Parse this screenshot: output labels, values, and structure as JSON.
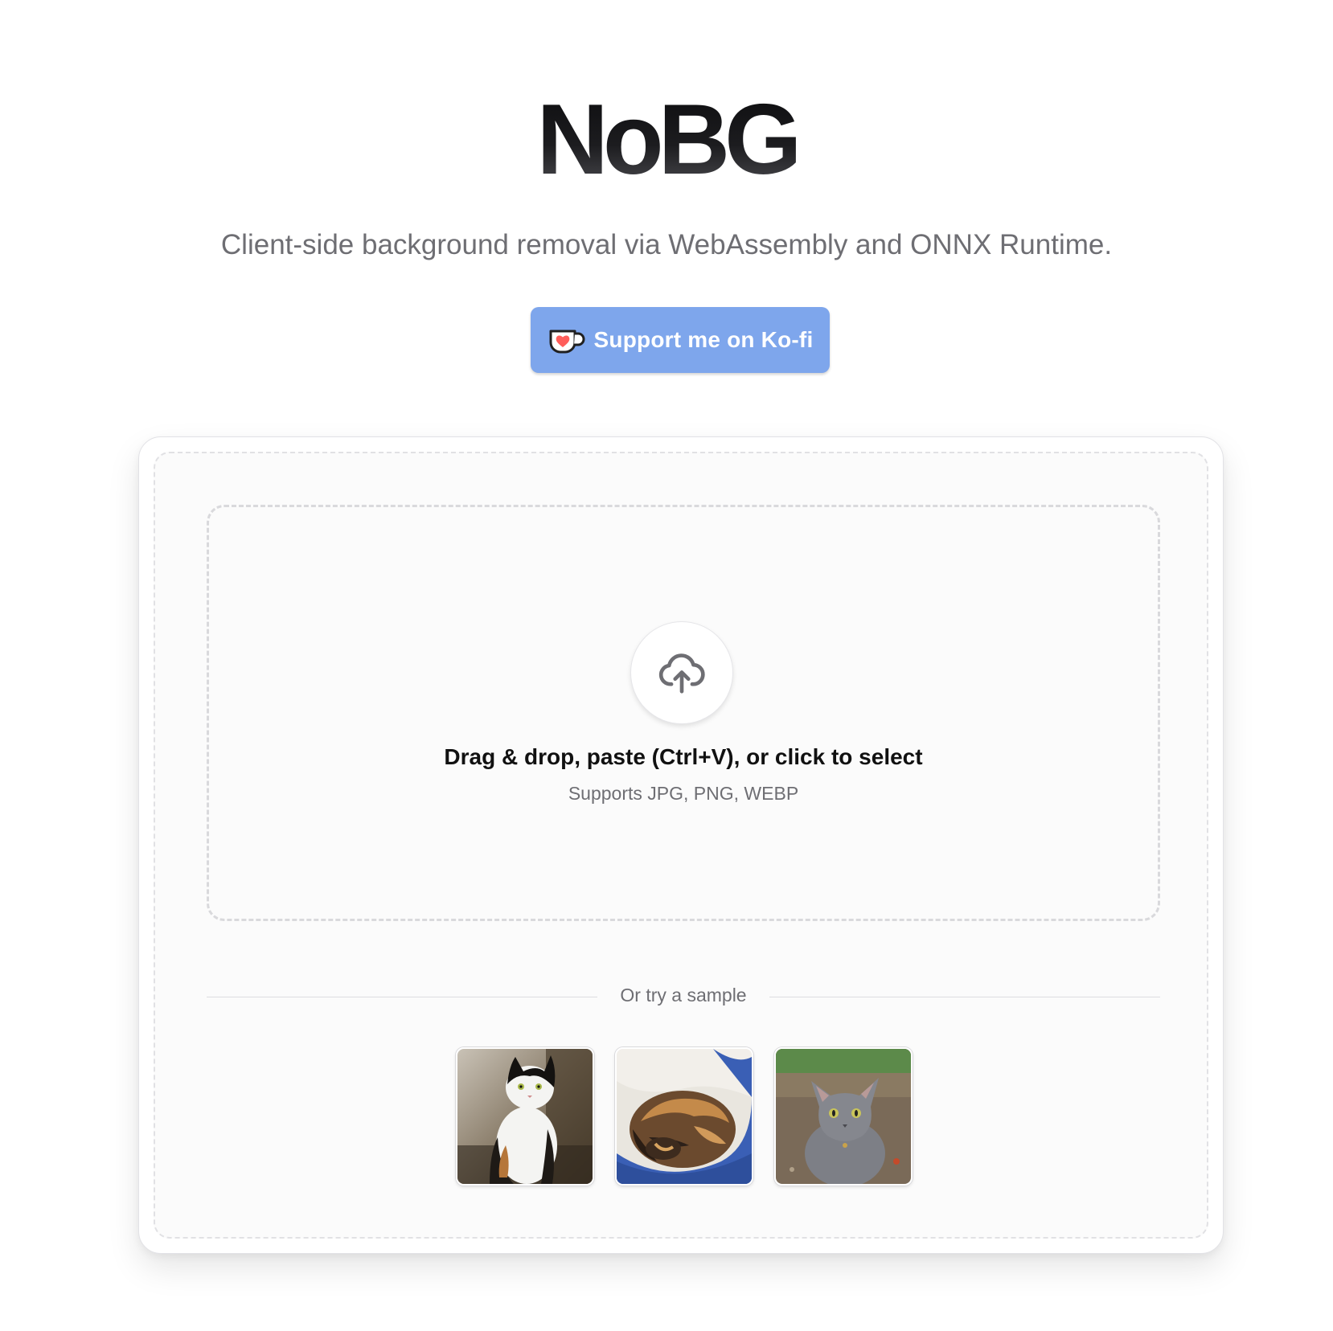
{
  "header": {
    "title": "NoBG",
    "subtitle": "Client-side background removal via WebAssembly and ONNX Runtime."
  },
  "support_button": {
    "label": "Support me on Ko-fi",
    "icon": "kofi-cup-heart-icon",
    "color": "#7ea6ec"
  },
  "dropzone": {
    "icon": "cloud-upload-icon",
    "title": "Drag & drop, paste (Ctrl+V), or click to select",
    "subtitle": "Supports JPG, PNG, WEBP"
  },
  "samples": {
    "divider_label": "Or try a sample",
    "items": [
      {
        "name": "sample-cat-calico-sitting"
      },
      {
        "name": "sample-cat-tortoiseshell-curled"
      },
      {
        "name": "sample-cat-gray"
      }
    ]
  }
}
